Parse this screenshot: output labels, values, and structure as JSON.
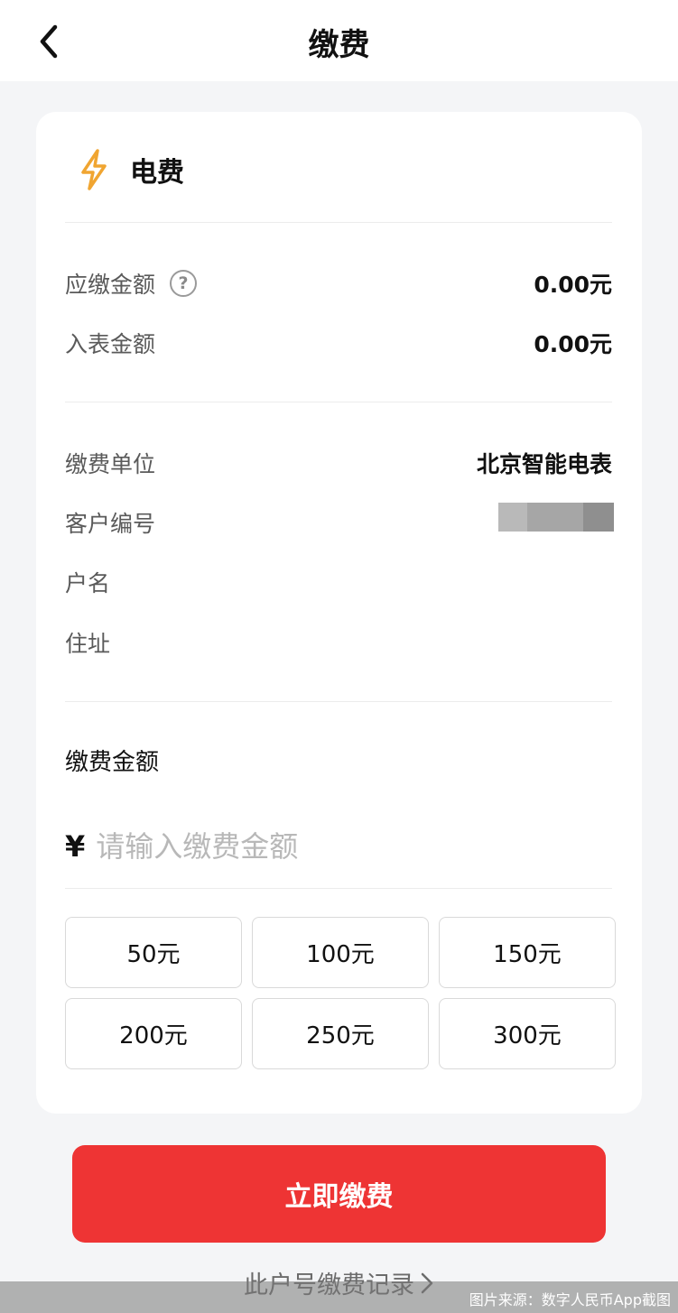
{
  "header": {
    "title": "缴费",
    "back_icon": "chevron-left-icon"
  },
  "bill": {
    "icon": "lightning-bolt-icon",
    "icon_color": "#f0a531",
    "name": "电费"
  },
  "amounts": {
    "due_label": "应缴金额",
    "due_value": "0.00元",
    "meter_label": "入表金额",
    "meter_value": "0.00元"
  },
  "account": {
    "unit_label": "缴费单位",
    "unit_value": "北京智能电表",
    "customer_no_label": "客户编号",
    "customer_no_value": "",
    "name_label": "户名",
    "name_value": "",
    "address_label": "住址",
    "address_value": ""
  },
  "payment": {
    "section_title": "缴费金额",
    "currency_symbol": "¥",
    "input_placeholder": "请输入缴费金额",
    "input_value": "",
    "presets": [
      "50元",
      "100元",
      "150元",
      "200元",
      "250元",
      "300元"
    ]
  },
  "actions": {
    "pay_label": "立即缴费",
    "pay_color": "#ee3434",
    "records_label": "此户号缴费记录"
  },
  "caption": "图片来源：数字人民币App截图"
}
